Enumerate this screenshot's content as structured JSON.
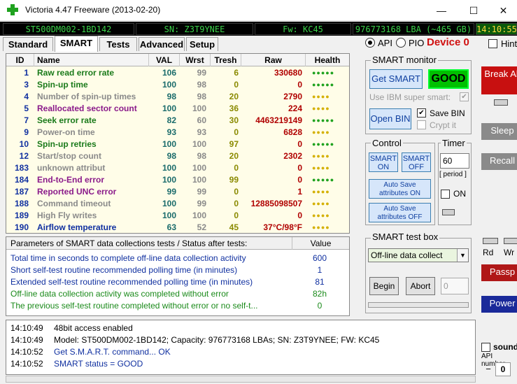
{
  "window": {
    "title": "Victoria 4.47  Freeware (2013-02-20)",
    "minimize": "—",
    "maximize": "☐",
    "close": "✕"
  },
  "statusbar": {
    "model": "ST500DM002-1BD142",
    "sn": "SN: Z3T9YNEE",
    "fw": "Fw: KC45",
    "lba": "976773168 LBA (~465 GB)",
    "time": "14:10:55"
  },
  "tabs": [
    "Standard",
    "SMART",
    "Tests",
    "Advanced",
    "Setup"
  ],
  "mode": {
    "api": "API",
    "pio": "PIO",
    "device": "Device 0",
    "hint": "Hint"
  },
  "smart_table": {
    "headers": [
      "ID",
      "Name",
      "VAL",
      "Wrst",
      "Tresh",
      "Raw",
      "Health"
    ],
    "rows": [
      {
        "id": "1",
        "name": "Raw read error rate",
        "val": "106",
        "wrst": "99",
        "tresh": "6",
        "raw": "330680",
        "health": "●●●●●",
        "hcolor": "#1fa21f",
        "ncolor": "#1a7a1a"
      },
      {
        "id": "3",
        "name": "Spin-up time",
        "val": "100",
        "wrst": "98",
        "tresh": "0",
        "raw": "0",
        "health": "●●●●●",
        "hcolor": "#1fa21f",
        "ncolor": "#1a7a1a"
      },
      {
        "id": "4",
        "name": "Number of spin-up times",
        "val": "98",
        "wrst": "98",
        "tresh": "20",
        "raw": "2790",
        "health": "●●●●",
        "hcolor": "#d4b000",
        "ncolor": "#8a8a8a"
      },
      {
        "id": "5",
        "name": "Reallocated sector count",
        "val": "100",
        "wrst": "100",
        "tresh": "36",
        "raw": "224",
        "health": "●●●●",
        "hcolor": "#d4b000",
        "ncolor": "#8a1a8a"
      },
      {
        "id": "7",
        "name": "Seek error rate",
        "val": "82",
        "wrst": "60",
        "tresh": "30",
        "raw": "4463219149",
        "health": "●●●●●",
        "hcolor": "#1fa21f",
        "ncolor": "#1a7a1a"
      },
      {
        "id": "9",
        "name": "Power-on time",
        "val": "93",
        "wrst": "93",
        "tresh": "0",
        "raw": "6828",
        "health": "●●●●",
        "hcolor": "#d4b000",
        "ncolor": "#8a8a8a"
      },
      {
        "id": "10",
        "name": "Spin-up retries",
        "val": "100",
        "wrst": "100",
        "tresh": "97",
        "raw": "0",
        "health": "●●●●●",
        "hcolor": "#1fa21f",
        "ncolor": "#1a7a1a"
      },
      {
        "id": "12",
        "name": "Start/stop count",
        "val": "98",
        "wrst": "98",
        "tresh": "20",
        "raw": "2302",
        "health": "●●●●",
        "hcolor": "#d4b000",
        "ncolor": "#8a8a8a"
      },
      {
        "id": "183",
        "name": "unknown attribut",
        "val": "100",
        "wrst": "100",
        "tresh": "0",
        "raw": "0",
        "health": "●●●●",
        "hcolor": "#d4b000",
        "ncolor": "#8a8a8a"
      },
      {
        "id": "184",
        "name": "End-to-End error",
        "val": "100",
        "wrst": "100",
        "tresh": "99",
        "raw": "0",
        "health": "●●●●●",
        "hcolor": "#1fa21f",
        "ncolor": "#8a1a8a"
      },
      {
        "id": "187",
        "name": "Reported UNC error",
        "val": "99",
        "wrst": "99",
        "tresh": "0",
        "raw": "1",
        "health": "●●●●",
        "hcolor": "#d4b000",
        "ncolor": "#8a1a8a"
      },
      {
        "id": "188",
        "name": "Command timeout",
        "val": "100",
        "wrst": "99",
        "tresh": "0",
        "raw": "12885098507",
        "health": "●●●●",
        "hcolor": "#d4b000",
        "ncolor": "#8a8a8a"
      },
      {
        "id": "189",
        "name": "High Fly writes",
        "val": "100",
        "wrst": "100",
        "tresh": "0",
        "raw": "0",
        "health": "●●●●",
        "hcolor": "#d4b000",
        "ncolor": "#8a8a8a"
      },
      {
        "id": "190",
        "name": "Airflow temperature",
        "val": "63",
        "wrst": "52",
        "tresh": "45",
        "raw": "37°C/98°F",
        "health": "●●●●",
        "hcolor": "#d4b000",
        "ncolor": "#1030a0"
      }
    ]
  },
  "params": {
    "header_label": "Parameters of SMART data collections tests / Status after tests:",
    "header_value": "Value",
    "rows": [
      {
        "label": "Total time in seconds to complete off-line data collection activity",
        "value": "600",
        "color": "#1030a0"
      },
      {
        "label": "Short self-test routine recommended polling time (in minutes)",
        "value": "1",
        "color": "#1030a0"
      },
      {
        "label": "Extended self-test routine recommended polling time (in minutes)",
        "value": "81",
        "color": "#1030a0"
      },
      {
        "label": "Off-line data collection activity was completed without error",
        "value": "82h",
        "color": "#1a8a1a"
      },
      {
        "label": "The previous self-test routine completed without error or no self-t...",
        "value": "0",
        "color": "#1a8a1a"
      }
    ]
  },
  "smart_monitor": {
    "title": "SMART monitor",
    "get_smart": "Get SMART",
    "status": "GOOD",
    "use_ibm": "Use IBM super smart:",
    "open_bin": "Open BIN",
    "save_bin": "Save BIN",
    "crypt_it": "Crypt it"
  },
  "control": {
    "title": "Control",
    "smart_on": "SMART ON",
    "smart_off": "SMART OFF",
    "auto_save_on": "Auto Save attributes ON",
    "auto_save_off": "Auto Save attributes OFF"
  },
  "timer": {
    "title": "Timer",
    "value": "60",
    "period": "[ period ]",
    "on": "ON"
  },
  "test_box": {
    "title": "SMART test box",
    "selected": "Off-line data collect",
    "begin": "Begin",
    "abort": "Abort",
    "counter": "0"
  },
  "right_panel": {
    "break_all": "Break All",
    "sleep": "Sleep",
    "recall": "Recall",
    "rd": "Rd",
    "wr": "Wr",
    "passp": "Passp",
    "power": "Power",
    "sound": "sound",
    "api_number": "API number",
    "api_value": "0",
    "minus": "−"
  },
  "log": [
    {
      "time": "14:10:49",
      "msg": "48bit access enabled",
      "color": "#000000"
    },
    {
      "time": "14:10:49",
      "msg": "Model: ST500DM002-1BD142; Capacity: 976773168 LBAs; SN: Z3T9YNEE; FW: KC45",
      "color": "#000000"
    },
    {
      "time": "14:10:52",
      "msg": "Get S.M.A.R.T. command... OK",
      "color": "#1030a0"
    },
    {
      "time": "14:10:52",
      "msg": "SMART status = GOOD",
      "color": "#1030a0"
    }
  ]
}
